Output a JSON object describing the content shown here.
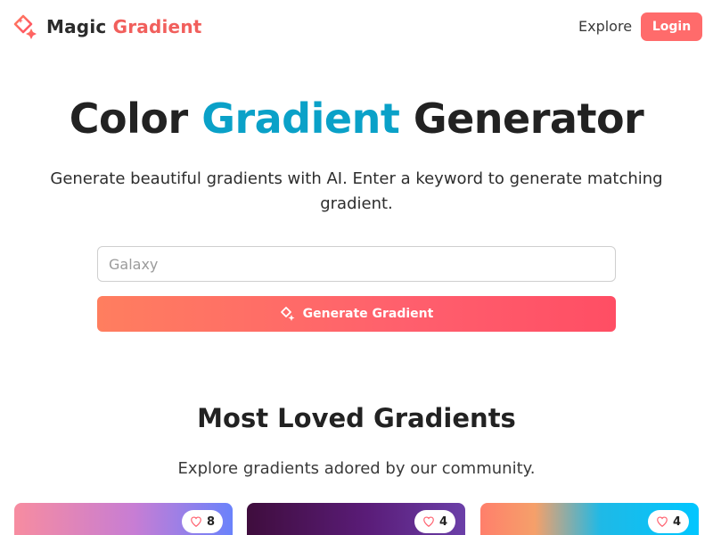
{
  "header": {
    "brand_word1": "Magic",
    "brand_word2": "Gradient",
    "nav_explore": "Explore",
    "login_label": "Login"
  },
  "hero": {
    "title_part1": "Color",
    "title_accent": "Gradient",
    "title_part2": "Generator",
    "subtitle": "Generate beautiful gradients with AI. Enter a keyword to generate matching gradient.",
    "search_placeholder": "Galaxy",
    "generate_label": "Generate Gradient"
  },
  "loved": {
    "title": "Most Loved Gradients",
    "subtitle": "Explore gradients adored by our community.",
    "cards": [
      {
        "likes": "8",
        "colors": [
          "#f78ca0",
          "#c77dd4",
          "#6a82fb"
        ]
      },
      {
        "likes": "4",
        "colors": [
          "#3f0d3d",
          "#5a1c78",
          "#6b3fa8"
        ]
      },
      {
        "likes": "4",
        "colors": [
          "#ff7f6b",
          "#f5a06a",
          "#1fb9e6",
          "#00c6ff"
        ]
      }
    ]
  },
  "icons": {
    "logo": "sparkle-diamond-icon",
    "generate": "sparkle-icon",
    "like": "heart-outline-icon"
  },
  "colors": {
    "brand_accent": "#f15f5c",
    "title_accent": "#0aa1c8",
    "login_bg": "#ff6b6b",
    "generate_gradient_start": "#ff7e5f",
    "generate_gradient_end": "#ff4e64"
  }
}
